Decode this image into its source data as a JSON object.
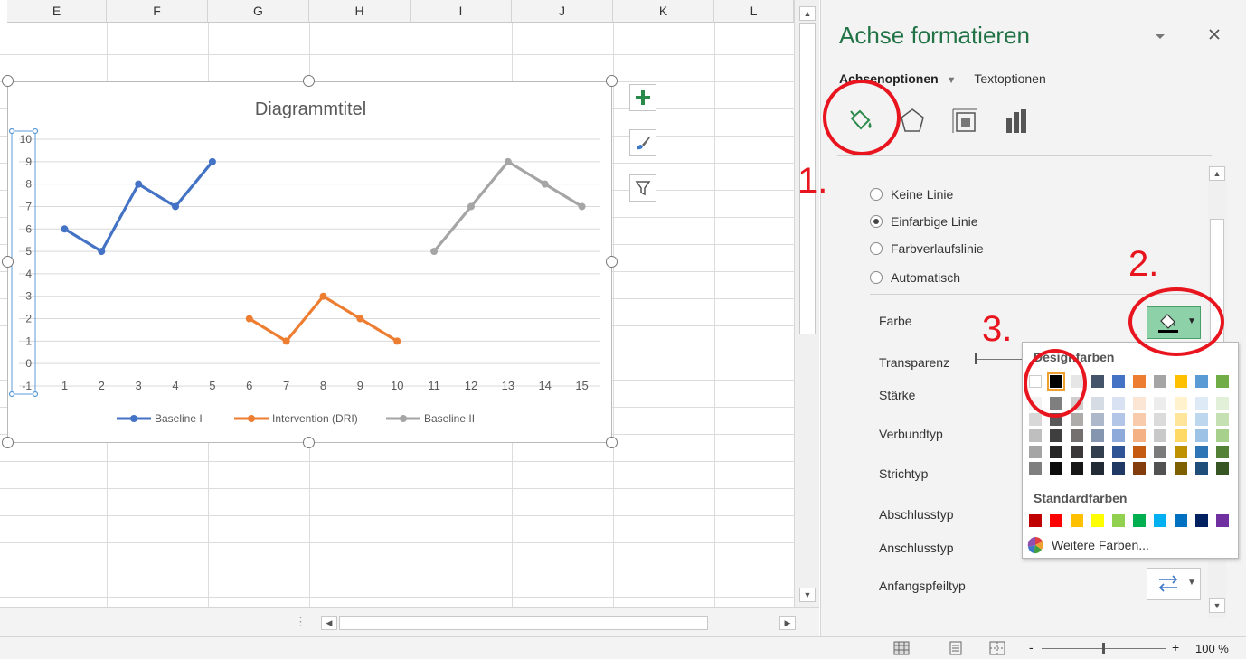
{
  "sheet": {
    "columns": [
      "E",
      "F",
      "G",
      "H",
      "I",
      "J",
      "K",
      "L"
    ]
  },
  "chart_data": {
    "type": "line",
    "title": "Diagrammtitel",
    "x": [
      1,
      2,
      3,
      4,
      5,
      6,
      7,
      8,
      9,
      10,
      11,
      12,
      13,
      14,
      15
    ],
    "ylim": [
      -1,
      10
    ],
    "yticks": [
      -1,
      0,
      1,
      2,
      3,
      4,
      5,
      6,
      7,
      8,
      9,
      10
    ],
    "grid": true,
    "legend_position": "bottom",
    "series": [
      {
        "name": "Baseline I",
        "color": "#4472c4",
        "x": [
          1,
          2,
          3,
          4,
          5
        ],
        "values": [
          6,
          5,
          8,
          7,
          9
        ]
      },
      {
        "name": "Intervention (DRI)",
        "color": "#ed7d31",
        "x": [
          6,
          7,
          8,
          9,
          10
        ],
        "values": [
          2,
          1,
          3,
          2,
          1
        ]
      },
      {
        "name": "Baseline II",
        "color": "#a5a5a5",
        "x": [
          11,
          12,
          13,
          14,
          15
        ],
        "values": [
          5,
          7,
          9,
          8,
          7
        ]
      }
    ]
  },
  "chart_tools": [
    "plus-icon",
    "brush-icon",
    "filter-icon"
  ],
  "pane": {
    "title": "Achse formatieren",
    "tab_active": "Achsenoptionen",
    "tab_other": "Textoptionen",
    "icons": [
      "fill-line-icon",
      "effects-icon",
      "size-properties-icon",
      "axis-options-icon"
    ],
    "line_options": [
      {
        "label": "Keine Linie",
        "selected": false
      },
      {
        "label": "Einfarbige Linie",
        "selected": true
      },
      {
        "label": "Farbverlaufslinie",
        "selected": false
      },
      {
        "label": "Automatisch",
        "selected": false
      }
    ],
    "farbe": "Farbe",
    "transparenz": "Transparenz",
    "staerke": "Stärke",
    "verbundtyp": "Verbundtyp",
    "strichtyp": "Strichtyp",
    "abschlusstyp": "Abschlusstyp",
    "anschlusstyp": "Anschlusstyp",
    "anfangspfeiltyp": "Anfangspfeiltyp"
  },
  "palette": {
    "design_label": "Designfarben",
    "standard_label": "Standardfarben",
    "more_label": "Weitere Farben...",
    "theme_top": [
      "#ffffff",
      "#000000",
      "#e7e6e6",
      "#44546a",
      "#4472c4",
      "#ed7d31",
      "#a5a5a5",
      "#ffc000",
      "#5b9bd5",
      "#70ad47"
    ],
    "theme_shades": [
      [
        "#f2f2f2",
        "#7f7f7f",
        "#d0cece",
        "#d6dce4",
        "#d9e2f3",
        "#fbe5d5",
        "#ededed",
        "#fff2cc",
        "#deebf6",
        "#e2efd9"
      ],
      [
        "#d8d8d8",
        "#595959",
        "#aeabab",
        "#adb9ca",
        "#b4c6e7",
        "#f7cbac",
        "#dbdbdb",
        "#fee599",
        "#bdd7ee",
        "#c5e0b3"
      ],
      [
        "#bfbfbf",
        "#3f3f3f",
        "#757070",
        "#8496b0",
        "#8eaadb",
        "#f4b183",
        "#c9c9c9",
        "#ffd965",
        "#9cc3e5",
        "#a8d08d"
      ],
      [
        "#a5a5a5",
        "#262626",
        "#3a3838",
        "#323f4f",
        "#2f5496",
        "#c55a11",
        "#7b7b7b",
        "#bf9000",
        "#2e75b5",
        "#538135"
      ],
      [
        "#7f7f7f",
        "#0c0c0c",
        "#171616",
        "#222a35",
        "#1f3864",
        "#833c0b",
        "#525252",
        "#7f6000",
        "#1e4e79",
        "#375623"
      ]
    ],
    "standard": [
      "#c00000",
      "#ff0000",
      "#ffc000",
      "#ffff00",
      "#92d050",
      "#00b050",
      "#00b0f0",
      "#0070c0",
      "#002060",
      "#7030a0"
    ]
  },
  "annotations": [
    "1.",
    "2.",
    "3."
  ],
  "status": {
    "zoom": "100 %",
    "zoom_minus": "-",
    "zoom_plus": "+"
  }
}
